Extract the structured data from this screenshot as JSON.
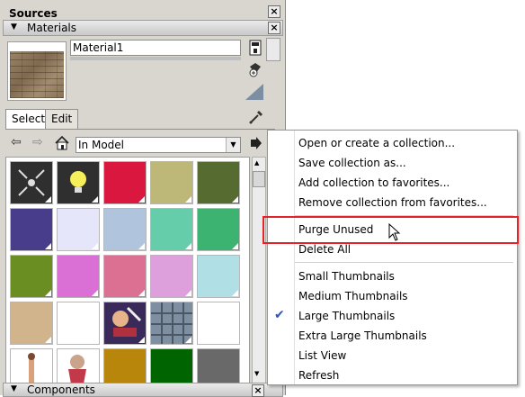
{
  "panel": {
    "title": "Sources",
    "close": "×",
    "materials_section": "Materials",
    "material_name": "Material1",
    "tabs": [
      "Select",
      "Edit"
    ],
    "collection": "In Model",
    "components_section": "Components"
  },
  "swatches": [
    {
      "color": "#2f2f2f",
      "icon": "shrink-arrows-icon"
    },
    {
      "color": "#2f2f2f",
      "icon": "lightbulb-icon"
    },
    {
      "color": "#d9173f"
    },
    {
      "color": "#bdb877"
    },
    {
      "color": "#556b2f"
    },
    {
      "color": "#483d8b"
    },
    {
      "color": "#e6e6fa"
    },
    {
      "color": "#b0c4de"
    },
    {
      "color": "#66cdaa"
    },
    {
      "color": "#3cb371"
    },
    {
      "color": "#6b8e23"
    },
    {
      "color": "#da70d6"
    },
    {
      "color": "#db7093"
    },
    {
      "color": "#dda0dd"
    },
    {
      "color": "#b0e0e6"
    },
    {
      "color": "#d2b48c"
    },
    {
      "color": "#ffffff"
    },
    {
      "color": "#3a2a5a",
      "icon": "anime-artwork-icon"
    },
    {
      "color": "#7d8fa0",
      "icon": "glass-texture-icon"
    },
    {
      "color": "#ffffff"
    },
    {
      "color": "#ffffff",
      "icon": "figure-image-icon"
    },
    {
      "color": "#ffffff",
      "icon": "character-image-icon"
    },
    {
      "color": "#b8860b"
    },
    {
      "color": "#006400"
    },
    {
      "color": "#696969"
    }
  ],
  "menu": {
    "items": [
      "Open or create a collection...",
      "Save collection as...",
      "Add collection to favorites...",
      "Remove collection from favorites...",
      "Purge Unused",
      "Delete All",
      "Small Thumbnails",
      "Medium Thumbnails",
      "Large Thumbnails",
      "Extra Large Thumbnails",
      "List View",
      "Refresh"
    ],
    "checked": "Large Thumbnails",
    "highlighted": "Purge Unused",
    "highlight_color": "#e0242a"
  }
}
